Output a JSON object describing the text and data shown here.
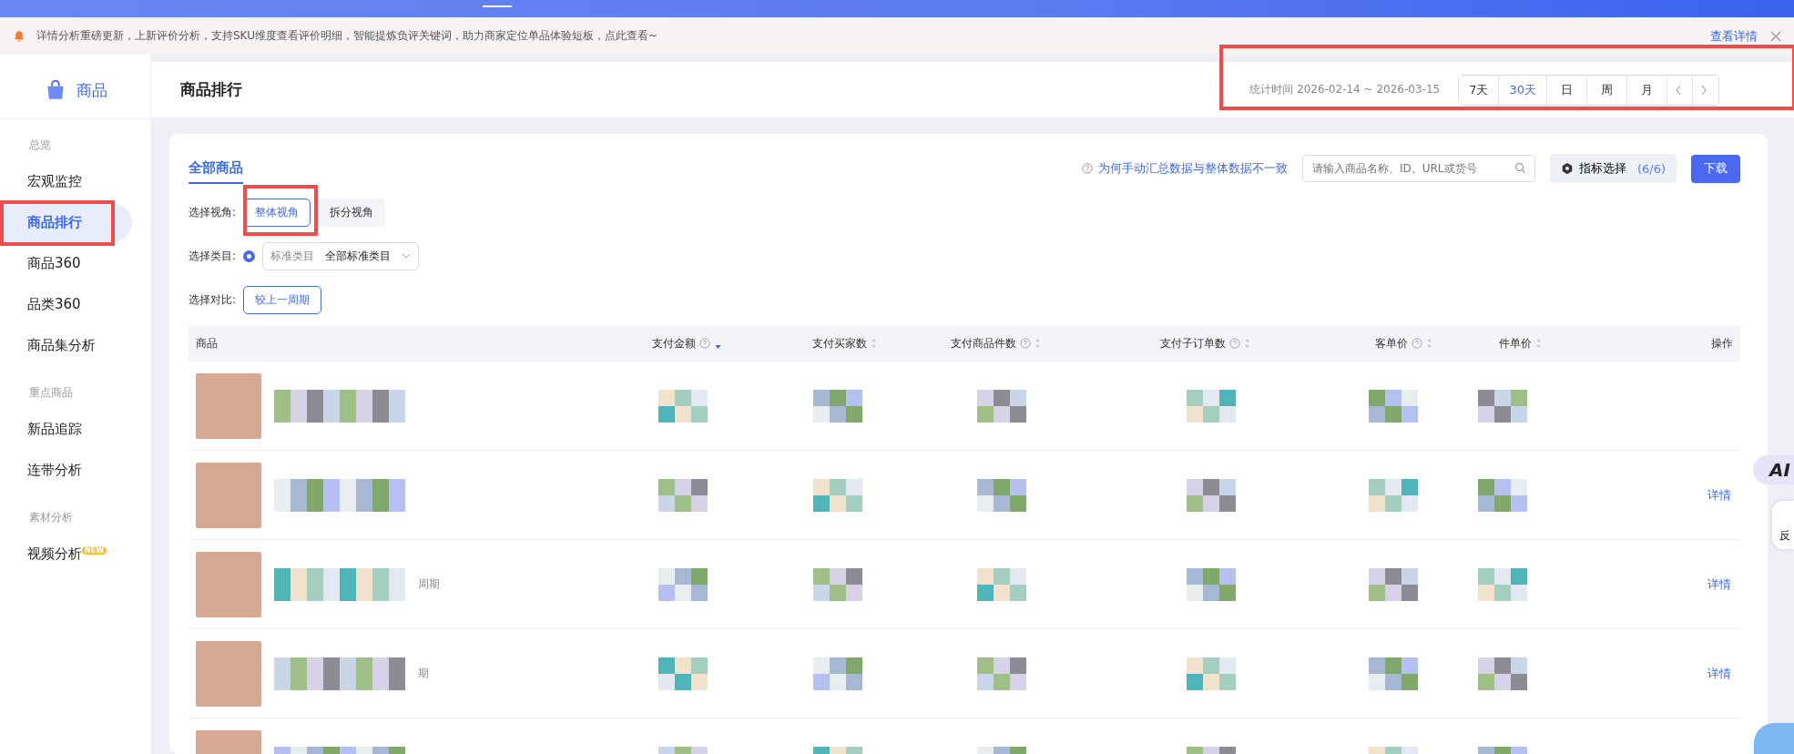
{
  "notice": {
    "text": "详情分析重磅更新，上新评价分析，支持SKU维度查看评价明细，智能提炼负评关键词，助力商家定位单品体验短板，点此查看~",
    "link": "查看详情"
  },
  "sidebar": {
    "brand": "商品",
    "sections": [
      {
        "title": "总览",
        "items": [
          {
            "label": "宏观监控",
            "selected": false
          },
          {
            "label": "商品排行",
            "selected": true
          },
          {
            "label": "商品360",
            "selected": false
          },
          {
            "label": "品类360",
            "selected": false
          },
          {
            "label": "商品集分析",
            "selected": false
          }
        ]
      },
      {
        "title": "重点商品",
        "items": [
          {
            "label": "新品追踪",
            "selected": false
          },
          {
            "label": "连带分析",
            "selected": false
          }
        ]
      },
      {
        "title": "素材分析",
        "items": [
          {
            "label": "视频分析",
            "selected": false,
            "badge": "NEW"
          }
        ]
      }
    ]
  },
  "header": {
    "title": "商品排行",
    "date_label": "统计时间 2026-02-14 ~ 2026-03-15",
    "ranges": [
      {
        "label": "7天",
        "selected": false
      },
      {
        "label": "30天",
        "selected": true
      },
      {
        "label": "日",
        "selected": false
      },
      {
        "label": "周",
        "selected": false
      },
      {
        "label": "月",
        "selected": false
      }
    ]
  },
  "card": {
    "tab": {
      "label": "全部商品",
      "selected": true
    },
    "help_link": "为何手动汇总数据与整体数据不一致",
    "search": {
      "placeholder": "请输入商品名称、ID、URL或货号"
    },
    "metric_button": {
      "label": "指标选择",
      "count": "(6/6)"
    },
    "download": "下载",
    "filters": [
      {
        "label": "选择视角:",
        "kind": "buttons",
        "options": [
          {
            "label": "整体视角",
            "selected": true
          },
          {
            "label": "拆分视角",
            "selected": false
          }
        ]
      },
      {
        "label": "选择类目:",
        "kind": "select",
        "radio_checked": true,
        "prefix": "标准类目",
        "value": "全部标准类目"
      },
      {
        "label": "选择对比:",
        "kind": "buttons",
        "options": [
          {
            "label": "较上一周期",
            "selected": true
          }
        ]
      }
    ]
  },
  "table": {
    "columns": [
      {
        "label": "商品",
        "help": false,
        "sortable": false
      },
      {
        "label": "支付金额",
        "help": true,
        "sortable": true,
        "sort_active": true
      },
      {
        "label": "支付买家数",
        "help": false,
        "sortable": true,
        "sort_active": false
      },
      {
        "label": "支付商品件数",
        "help": true,
        "sortable": true,
        "sort_active": false
      },
      {
        "label": "支付子订单数",
        "help": true,
        "sortable": true,
        "sort_active": false
      },
      {
        "label": "客单价",
        "help": true,
        "sortable": true,
        "sort_active": false
      },
      {
        "label": "件单价",
        "help": false,
        "sortable": true,
        "sort_active": false
      },
      {
        "label": "操作",
        "help": false,
        "sortable": false
      }
    ],
    "rows": [
      {},
      {
        "action": "详情"
      },
      {
        "fragment": "周期",
        "action": "详情"
      },
      {
        "fragment": "期",
        "action": "详情"
      },
      {}
    ]
  },
  "floating": {
    "ai": "AI",
    "feedback": "反"
  }
}
